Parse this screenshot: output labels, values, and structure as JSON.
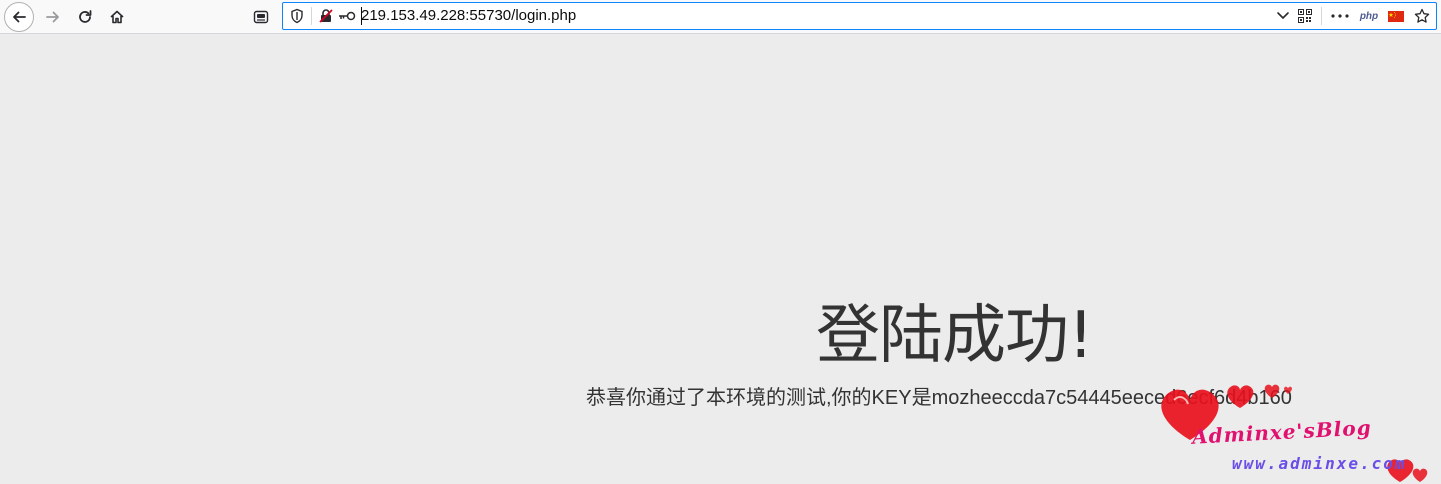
{
  "browser": {
    "url": "219.153.49.228:55730/login.php",
    "php_badge": "php"
  },
  "icons": {
    "back": "back-arrow-icon",
    "forward": "forward-arrow-icon",
    "reload": "reload-icon",
    "home": "home-icon",
    "reader": "reader-view-icon",
    "shield": "tracking-shield-icon",
    "insecure": "insecure-connection-icon",
    "key": "key-icon",
    "dropdown": "chevron-down-icon",
    "qr": "qr-code-icon",
    "more": "more-actions-icon",
    "flag": "china-flag-icon",
    "bookmark": "star-icon"
  },
  "page": {
    "heading": "登陆成功!",
    "message": "恭喜你通过了本环境的测试,你的KEY是mozheeccda7c54445eeced6ecf6d4b160"
  },
  "watermark": {
    "title": "Adminxe'sBlog",
    "url": "www.adminxe.com"
  },
  "colors": {
    "page_bg": "#ececec",
    "text": "#333333",
    "url_focus": "#0a84ff",
    "watermark_pink": "#e0116f",
    "watermark_purple": "#6a4ee8",
    "heart_red": "#e8101c"
  }
}
